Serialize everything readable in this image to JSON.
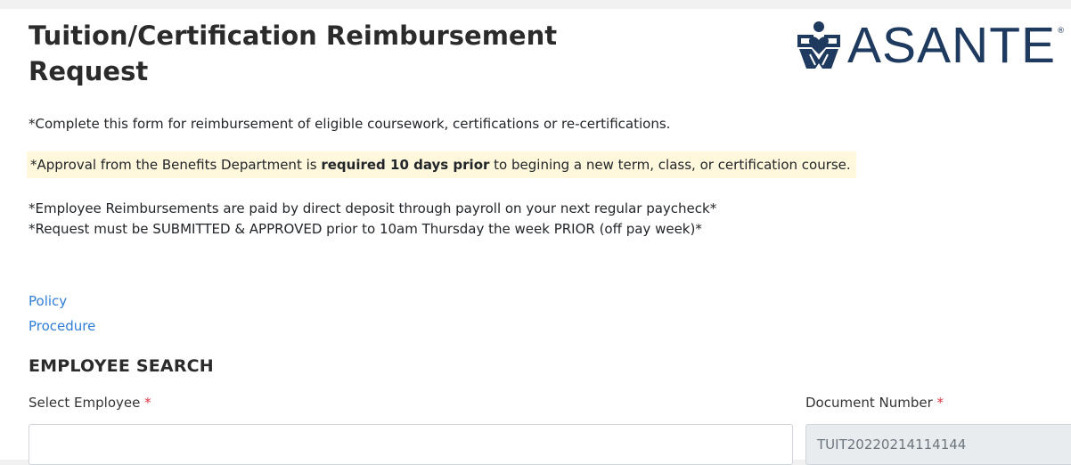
{
  "header": {
    "title": "Tuition/Certification Reimbursement Request",
    "logo_text": "ASANTE",
    "logo_registered": "®"
  },
  "notes": {
    "line1": "*Complete this form for reimbursement of eligible coursework, certifications or re-certifications.",
    "approval_prefix": "*Approval from the Benefits Department is ",
    "approval_bold": "required 10 days prior",
    "approval_suffix": " to begining a new term, class, or certification course.",
    "line3": "*Employee Reimbursements are paid by direct deposit through payroll on your next regular paycheck*",
    "line4": "*Request must be SUBMITTED & APPROVED prior to 10am Thursday the week PRIOR (off pay week)*"
  },
  "links": {
    "policy": "Policy",
    "procedure": "Procedure"
  },
  "employee_search": {
    "heading": "EMPLOYEE SEARCH",
    "select_employee_label": "Select Employee",
    "select_employee_value": "",
    "document_number_label": "Document Number",
    "document_number_value": "TUIT20220214114144",
    "required_marker": "*"
  },
  "colors": {
    "brand": "#1e3a5f",
    "link": "#2f7ed8",
    "required": "#dc3545",
    "highlight": "#fff8dc"
  }
}
